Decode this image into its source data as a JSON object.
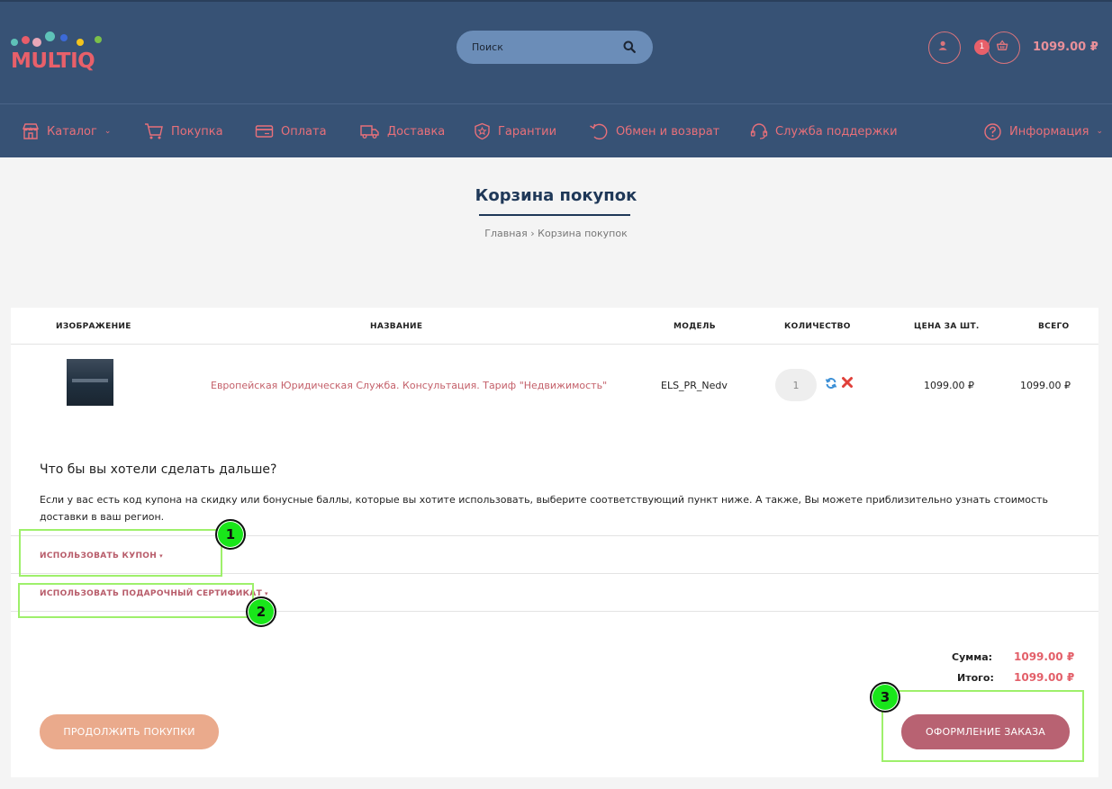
{
  "header": {
    "logo_text": "MULTIQ",
    "search_placeholder": "Поиск",
    "cart_count": "1",
    "cart_total": "1099.00 ₽"
  },
  "nav": {
    "items": [
      {
        "label": "Каталог",
        "icon": "store-icon",
        "dropdown": true
      },
      {
        "label": "Покупка",
        "icon": "cart-icon",
        "dropdown": false
      },
      {
        "label": "Оплата",
        "icon": "card-icon",
        "dropdown": false
      },
      {
        "label": "Доставка",
        "icon": "truck-icon",
        "dropdown": false
      },
      {
        "label": "Гарантии",
        "icon": "shield-icon",
        "dropdown": false
      },
      {
        "label": "Обмен и возврат",
        "icon": "undo-icon",
        "dropdown": false
      },
      {
        "label": "Служба поддержки",
        "icon": "headset-icon",
        "dropdown": false
      },
      {
        "label": "Информация",
        "icon": "help-icon",
        "dropdown": true
      }
    ]
  },
  "page": {
    "title": "Корзина покупок",
    "breadcrumb_home": "Главная",
    "breadcrumb_sep": "›",
    "breadcrumb_current": "Корзина покупок"
  },
  "table": {
    "columns": [
      "ИЗОБРАЖЕНИЕ",
      "НАЗВАНИЕ",
      "МОДЕЛЬ",
      "КОЛИЧЕСТВО",
      "ЦЕНА ЗА ШТ.",
      "ВСЕГО"
    ],
    "rows": [
      {
        "name": "Европейская Юридическая Служба. Консультация. Тариф \"Недвижимость\"",
        "model": "ELS_PR_Nedv",
        "quantity": "1",
        "unit_price": "1099.00 ₽",
        "total": "1099.00 ₽"
      }
    ]
  },
  "next_steps": {
    "title": "Что бы вы хотели сделать дальше?",
    "text": "Если у вас есть код купона на скидку или бонусные баллы, которые вы хотите использовать, выберите соответствующий пункт ниже. А также, Вы можете приблизительно узнать стоимость доставки в ваш регион.",
    "coupon_label": "ИСПОЛЬЗОВАТЬ КУПОН",
    "certificate_label": "ИСПОЛЬЗОВАТЬ ПОДАРОЧНЫЙ СЕРТИФИКАТ",
    "caret": "▾"
  },
  "totals": {
    "sum_label": "Сумма:",
    "sum_value": "1099.00 ₽",
    "total_label": "Итого:",
    "total_value": "1099.00 ₽"
  },
  "buttons": {
    "continue": "ПРОДОЛЖИТЬ ПОКУПКИ",
    "checkout": "ОФОРМЛЕНИЕ ЗАКАЗА"
  },
  "annotations": [
    "1",
    "2",
    "3"
  ],
  "colors": {
    "header_bg": "#375275",
    "accent": "#e8606a",
    "link": "#c4606a",
    "checkout": "#b86272",
    "continue": "#eaaa8c",
    "annotation": "#19e61a"
  }
}
